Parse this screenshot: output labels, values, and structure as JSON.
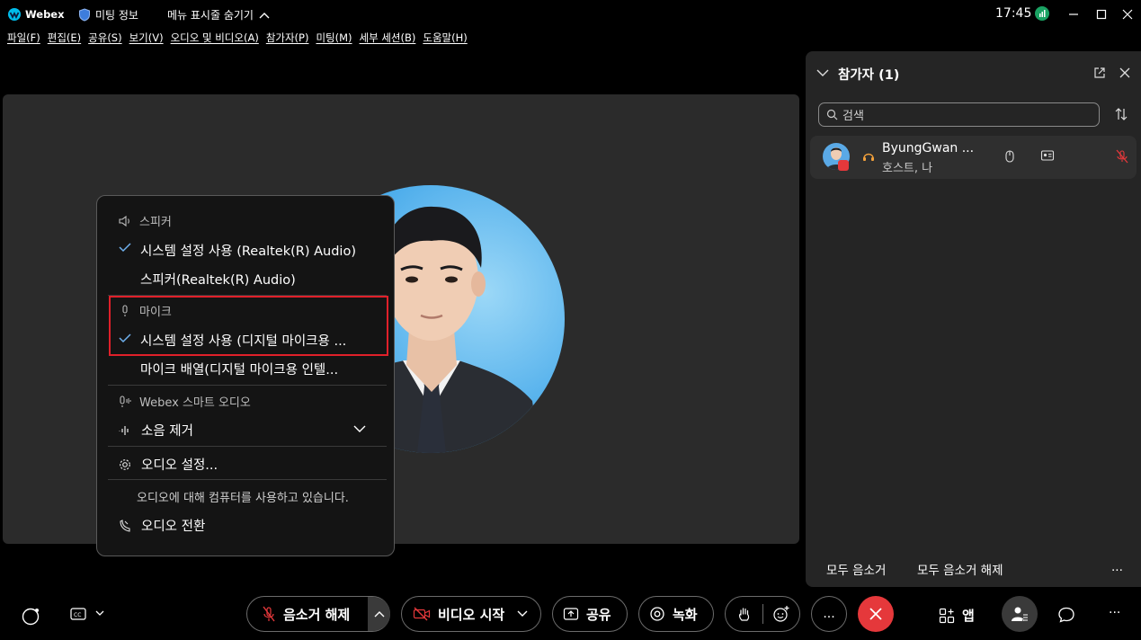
{
  "titlebar": {
    "app_name": "Webex",
    "meeting_info": "미팅 정보",
    "menu_toggle": "메뉴 표시줄 숨기기",
    "clock": "17:45"
  },
  "menubar": [
    "파일(F)",
    "편집(E)",
    "공유(S)",
    "보기(V)",
    "오디오 및 비디오(A)",
    "참가자(P)",
    "미팅(M)",
    "세부 세션(B)",
    "도움말(H)"
  ],
  "audio_menu": {
    "speaker_header": "스피커",
    "speaker_option_1": "시스템 설정 사용 (Realtek(R) Audio)",
    "speaker_option_2": "스피커(Realtek(R) Audio)",
    "mic_header": "마이크",
    "mic_option_1": "시스템 설정 사용 (디지털 마이크용 ...",
    "mic_option_2": "마이크 배열(디지털 마이크용 인텔...",
    "smart_audio_header": "Webex 스마트 오디오",
    "noise_removal": "소음 제거",
    "audio_settings": "오디오 설정...",
    "status_text": "오디오에 대해 컴퓨터를 사용하고 있습니다.",
    "switch_audio": "오디오 전환"
  },
  "participants_panel": {
    "title": "참가자 (1)",
    "search_placeholder": "검색",
    "participant_name": "ByungGwan ...",
    "participant_role": "호스트, 나",
    "mute_all": "모두 음소거",
    "unmute_all": "모두 음소거 해제",
    "more": "..."
  },
  "toolbar": {
    "unmute": "음소거 해제",
    "start_video": "비디오 시작",
    "share": "공유",
    "record": "녹화",
    "more": "...",
    "apps": "앱"
  },
  "colors": {
    "end_call": "#e5383b",
    "check": "#6fb1ef",
    "highlight_box": "#e0202a",
    "signal": "#1aa263"
  }
}
